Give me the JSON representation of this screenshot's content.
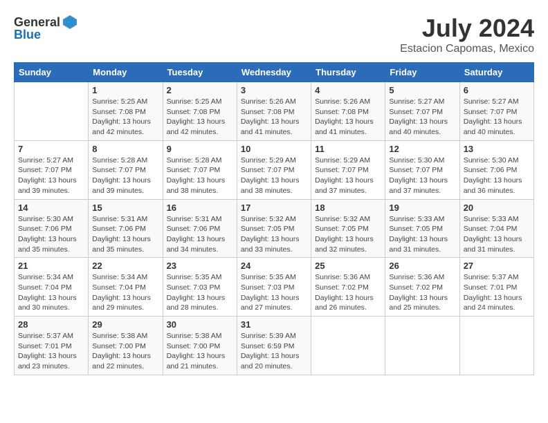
{
  "header": {
    "logo_general": "General",
    "logo_blue": "Blue",
    "month_year": "July 2024",
    "location": "Estacion Capomas, Mexico"
  },
  "weekdays": [
    "Sunday",
    "Monday",
    "Tuesday",
    "Wednesday",
    "Thursday",
    "Friday",
    "Saturday"
  ],
  "weeks": [
    [
      {
        "day": "",
        "detail": ""
      },
      {
        "day": "1",
        "detail": "Sunrise: 5:25 AM\nSunset: 7:08 PM\nDaylight: 13 hours\nand 42 minutes."
      },
      {
        "day": "2",
        "detail": "Sunrise: 5:25 AM\nSunset: 7:08 PM\nDaylight: 13 hours\nand 42 minutes."
      },
      {
        "day": "3",
        "detail": "Sunrise: 5:26 AM\nSunset: 7:08 PM\nDaylight: 13 hours\nand 41 minutes."
      },
      {
        "day": "4",
        "detail": "Sunrise: 5:26 AM\nSunset: 7:08 PM\nDaylight: 13 hours\nand 41 minutes."
      },
      {
        "day": "5",
        "detail": "Sunrise: 5:27 AM\nSunset: 7:07 PM\nDaylight: 13 hours\nand 40 minutes."
      },
      {
        "day": "6",
        "detail": "Sunrise: 5:27 AM\nSunset: 7:07 PM\nDaylight: 13 hours\nand 40 minutes."
      }
    ],
    [
      {
        "day": "7",
        "detail": "Sunrise: 5:27 AM\nSunset: 7:07 PM\nDaylight: 13 hours\nand 39 minutes."
      },
      {
        "day": "8",
        "detail": "Sunrise: 5:28 AM\nSunset: 7:07 PM\nDaylight: 13 hours\nand 39 minutes."
      },
      {
        "day": "9",
        "detail": "Sunrise: 5:28 AM\nSunset: 7:07 PM\nDaylight: 13 hours\nand 38 minutes."
      },
      {
        "day": "10",
        "detail": "Sunrise: 5:29 AM\nSunset: 7:07 PM\nDaylight: 13 hours\nand 38 minutes."
      },
      {
        "day": "11",
        "detail": "Sunrise: 5:29 AM\nSunset: 7:07 PM\nDaylight: 13 hours\nand 37 minutes."
      },
      {
        "day": "12",
        "detail": "Sunrise: 5:30 AM\nSunset: 7:07 PM\nDaylight: 13 hours\nand 37 minutes."
      },
      {
        "day": "13",
        "detail": "Sunrise: 5:30 AM\nSunset: 7:06 PM\nDaylight: 13 hours\nand 36 minutes."
      }
    ],
    [
      {
        "day": "14",
        "detail": "Sunrise: 5:30 AM\nSunset: 7:06 PM\nDaylight: 13 hours\nand 35 minutes."
      },
      {
        "day": "15",
        "detail": "Sunrise: 5:31 AM\nSunset: 7:06 PM\nDaylight: 13 hours\nand 35 minutes."
      },
      {
        "day": "16",
        "detail": "Sunrise: 5:31 AM\nSunset: 7:06 PM\nDaylight: 13 hours\nand 34 minutes."
      },
      {
        "day": "17",
        "detail": "Sunrise: 5:32 AM\nSunset: 7:05 PM\nDaylight: 13 hours\nand 33 minutes."
      },
      {
        "day": "18",
        "detail": "Sunrise: 5:32 AM\nSunset: 7:05 PM\nDaylight: 13 hours\nand 32 minutes."
      },
      {
        "day": "19",
        "detail": "Sunrise: 5:33 AM\nSunset: 7:05 PM\nDaylight: 13 hours\nand 31 minutes."
      },
      {
        "day": "20",
        "detail": "Sunrise: 5:33 AM\nSunset: 7:04 PM\nDaylight: 13 hours\nand 31 minutes."
      }
    ],
    [
      {
        "day": "21",
        "detail": "Sunrise: 5:34 AM\nSunset: 7:04 PM\nDaylight: 13 hours\nand 30 minutes."
      },
      {
        "day": "22",
        "detail": "Sunrise: 5:34 AM\nSunset: 7:04 PM\nDaylight: 13 hours\nand 29 minutes."
      },
      {
        "day": "23",
        "detail": "Sunrise: 5:35 AM\nSunset: 7:03 PM\nDaylight: 13 hours\nand 28 minutes."
      },
      {
        "day": "24",
        "detail": "Sunrise: 5:35 AM\nSunset: 7:03 PM\nDaylight: 13 hours\nand 27 minutes."
      },
      {
        "day": "25",
        "detail": "Sunrise: 5:36 AM\nSunset: 7:02 PM\nDaylight: 13 hours\nand 26 minutes."
      },
      {
        "day": "26",
        "detail": "Sunrise: 5:36 AM\nSunset: 7:02 PM\nDaylight: 13 hours\nand 25 minutes."
      },
      {
        "day": "27",
        "detail": "Sunrise: 5:37 AM\nSunset: 7:01 PM\nDaylight: 13 hours\nand 24 minutes."
      }
    ],
    [
      {
        "day": "28",
        "detail": "Sunrise: 5:37 AM\nSunset: 7:01 PM\nDaylight: 13 hours\nand 23 minutes."
      },
      {
        "day": "29",
        "detail": "Sunrise: 5:38 AM\nSunset: 7:00 PM\nDaylight: 13 hours\nand 22 minutes."
      },
      {
        "day": "30",
        "detail": "Sunrise: 5:38 AM\nSunset: 7:00 PM\nDaylight: 13 hours\nand 21 minutes."
      },
      {
        "day": "31",
        "detail": "Sunrise: 5:39 AM\nSunset: 6:59 PM\nDaylight: 13 hours\nand 20 minutes."
      },
      {
        "day": "",
        "detail": ""
      },
      {
        "day": "",
        "detail": ""
      },
      {
        "day": "",
        "detail": ""
      }
    ]
  ]
}
